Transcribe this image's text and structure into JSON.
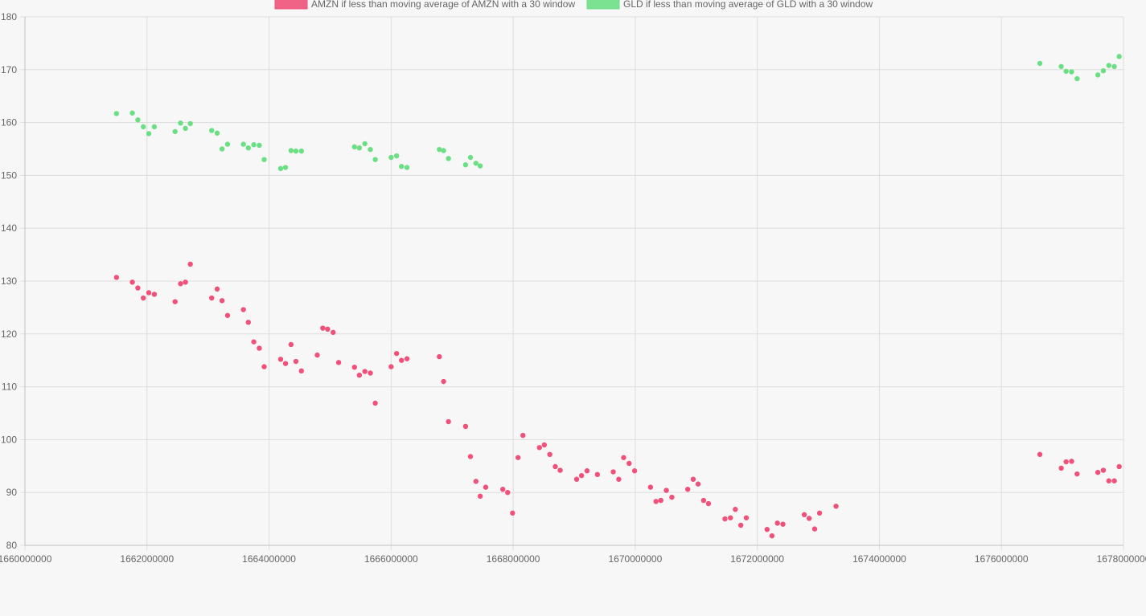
{
  "chart_data": {
    "type": "scatter",
    "title": "",
    "xlabel": "",
    "ylabel": "",
    "xlim": [
      1660000000,
      1678000000
    ],
    "ylim": [
      80,
      180
    ],
    "x_ticks": [
      1660000000,
      1662000000,
      1664000000,
      1666000000,
      1668000000,
      1670000000,
      1672000000,
      1674000000,
      1676000000,
      1678000000
    ],
    "y_ticks": [
      80,
      90,
      100,
      110,
      120,
      130,
      140,
      150,
      160,
      170,
      180
    ],
    "grid": true,
    "legend_position": "top",
    "series": [
      {
        "name": "AMZN if less than moving average of AMZN with a 30 window",
        "color": "#f0517a",
        "points": [
          [
            1661500000,
            130.7
          ],
          [
            1661760000,
            129.8
          ],
          [
            1661850000,
            128.7
          ],
          [
            1661940000,
            126.8
          ],
          [
            1662030000,
            127.8
          ],
          [
            1662120000,
            127.5
          ],
          [
            1662460000,
            126.1
          ],
          [
            1662550000,
            129.5
          ],
          [
            1662630000,
            129.8
          ],
          [
            1662710000,
            133.2
          ],
          [
            1663060000,
            126.8
          ],
          [
            1663150000,
            128.5
          ],
          [
            1663230000,
            126.3
          ],
          [
            1663320000,
            123.5
          ],
          [
            1663580000,
            124.6
          ],
          [
            1663660000,
            122.2
          ],
          [
            1663750000,
            118.5
          ],
          [
            1663840000,
            117.3
          ],
          [
            1663920000,
            113.8
          ],
          [
            1664190000,
            115.2
          ],
          [
            1664270000,
            114.4
          ],
          [
            1664360000,
            118.0
          ],
          [
            1664440000,
            114.8
          ],
          [
            1664530000,
            113.0
          ],
          [
            1664790000,
            116.0
          ],
          [
            1664880000,
            121.1
          ],
          [
            1664960000,
            120.9
          ],
          [
            1665050000,
            120.3
          ],
          [
            1665140000,
            114.6
          ],
          [
            1665400000,
            113.7
          ],
          [
            1665480000,
            112.2
          ],
          [
            1665570000,
            112.9
          ],
          [
            1665660000,
            112.6
          ],
          [
            1665740000,
            106.9
          ],
          [
            1666000000,
            113.8
          ],
          [
            1666090000,
            116.3
          ],
          [
            1666170000,
            115.0
          ],
          [
            1666260000,
            115.3
          ],
          [
            1666790000,
            115.7
          ],
          [
            1666860000,
            111.0
          ],
          [
            1666940000,
            103.4
          ],
          [
            1667220000,
            102.5
          ],
          [
            1667300000,
            96.8
          ],
          [
            1667390000,
            92.1
          ],
          [
            1667460000,
            89.3
          ],
          [
            1667550000,
            91.0
          ],
          [
            1667830000,
            90.6
          ],
          [
            1667910000,
            90.0
          ],
          [
            1667990000,
            86.1
          ],
          [
            1668080000,
            96.6
          ],
          [
            1668160000,
            100.8
          ],
          [
            1668430000,
            98.5
          ],
          [
            1668510000,
            99.0
          ],
          [
            1668600000,
            97.2
          ],
          [
            1668690000,
            94.9
          ],
          [
            1668770000,
            94.2
          ],
          [
            1669040000,
            92.5
          ],
          [
            1669120000,
            93.2
          ],
          [
            1669210000,
            94.1
          ],
          [
            1669380000,
            93.4
          ],
          [
            1669640000,
            93.9
          ],
          [
            1669730000,
            92.5
          ],
          [
            1669810000,
            96.6
          ],
          [
            1669900000,
            95.5
          ],
          [
            1669990000,
            94.1
          ],
          [
            1670250000,
            91.0
          ],
          [
            1670340000,
            88.3
          ],
          [
            1670420000,
            88.5
          ],
          [
            1670510000,
            90.4
          ],
          [
            1670600000,
            89.1
          ],
          [
            1670860000,
            90.6
          ],
          [
            1670950000,
            92.5
          ],
          [
            1671030000,
            91.6
          ],
          [
            1671120000,
            88.5
          ],
          [
            1671200000,
            87.9
          ],
          [
            1671470000,
            85.0
          ],
          [
            1671560000,
            85.2
          ],
          [
            1671640000,
            86.8
          ],
          [
            1671730000,
            83.8
          ],
          [
            1671820000,
            85.2
          ],
          [
            1672160000,
            83.0
          ],
          [
            1672240000,
            81.8
          ],
          [
            1672330000,
            84.2
          ],
          [
            1672420000,
            84.0
          ],
          [
            1672770000,
            85.8
          ],
          [
            1672850000,
            85.1
          ],
          [
            1672940000,
            83.1
          ],
          [
            1673020000,
            86.1
          ],
          [
            1673290000,
            87.4
          ],
          [
            1676630000,
            97.2
          ],
          [
            1676980000,
            94.6
          ],
          [
            1677060000,
            95.8
          ],
          [
            1677150000,
            95.9
          ],
          [
            1677240000,
            93.5
          ],
          [
            1677580000,
            93.8
          ],
          [
            1677670000,
            94.2
          ],
          [
            1677760000,
            92.2
          ],
          [
            1677850000,
            92.2
          ],
          [
            1677930000,
            94.9
          ]
        ]
      },
      {
        "name": "GLD if less than moving average of GLD with a 30 window",
        "color": "#6bdf84",
        "points": [
          [
            1661500000,
            161.7
          ],
          [
            1661760000,
            161.8
          ],
          [
            1661850000,
            160.5
          ],
          [
            1661940000,
            159.2
          ],
          [
            1662030000,
            157.9
          ],
          [
            1662120000,
            159.2
          ],
          [
            1662460000,
            158.3
          ],
          [
            1662550000,
            159.9
          ],
          [
            1662630000,
            158.9
          ],
          [
            1662710000,
            159.8
          ],
          [
            1663060000,
            158.5
          ],
          [
            1663150000,
            158.0
          ],
          [
            1663230000,
            155.0
          ],
          [
            1663320000,
            155.9
          ],
          [
            1663580000,
            155.9
          ],
          [
            1663660000,
            155.2
          ],
          [
            1663750000,
            155.8
          ],
          [
            1663840000,
            155.7
          ],
          [
            1663920000,
            153.0
          ],
          [
            1664190000,
            151.3
          ],
          [
            1664270000,
            151.5
          ],
          [
            1664360000,
            154.7
          ],
          [
            1664440000,
            154.6
          ],
          [
            1664530000,
            154.6
          ],
          [
            1665400000,
            155.4
          ],
          [
            1665480000,
            155.2
          ],
          [
            1665570000,
            156.0
          ],
          [
            1665660000,
            154.9
          ],
          [
            1665740000,
            153.0
          ],
          [
            1666000000,
            153.4
          ],
          [
            1666090000,
            153.7
          ],
          [
            1666170000,
            151.7
          ],
          [
            1666260000,
            151.5
          ],
          [
            1666790000,
            154.9
          ],
          [
            1666860000,
            154.7
          ],
          [
            1666940000,
            153.2
          ],
          [
            1667220000,
            152.0
          ],
          [
            1667300000,
            153.4
          ],
          [
            1667390000,
            152.3
          ],
          [
            1667460000,
            151.8
          ],
          [
            1676630000,
            171.2
          ],
          [
            1676980000,
            170.6
          ],
          [
            1677060000,
            169.7
          ],
          [
            1677150000,
            169.6
          ],
          [
            1677240000,
            168.3
          ],
          [
            1677580000,
            169.0
          ],
          [
            1677670000,
            169.8
          ],
          [
            1677760000,
            170.8
          ],
          [
            1677850000,
            170.6
          ],
          [
            1677930000,
            172.5
          ]
        ]
      }
    ]
  }
}
